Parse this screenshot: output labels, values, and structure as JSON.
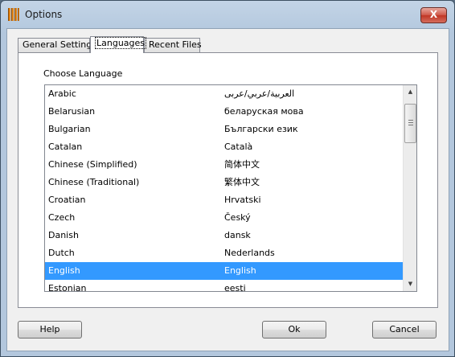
{
  "window": {
    "title": "Options",
    "close_label": "X"
  },
  "tabs": [
    {
      "label": "General Settings",
      "active": false
    },
    {
      "label": "Languages",
      "active": true
    },
    {
      "label": "Recent Files",
      "active": false
    }
  ],
  "languages": {
    "label": "Choose Language",
    "selected": "English",
    "items": [
      {
        "name": "Arabic",
        "native": "العربية/عربي/عربى"
      },
      {
        "name": "Belarusian",
        "native": "беларуская мова"
      },
      {
        "name": "Bulgarian",
        "native": "Български език"
      },
      {
        "name": "Catalan",
        "native": "Català"
      },
      {
        "name": "Chinese (Simplified)",
        "native": "简体中文"
      },
      {
        "name": "Chinese (Traditional)",
        "native": "繁体中文"
      },
      {
        "name": "Croatian",
        "native": "Hrvatski"
      },
      {
        "name": "Czech",
        "native": "Český"
      },
      {
        "name": "Danish",
        "native": "dansk"
      },
      {
        "name": "Dutch",
        "native": "Nederlands"
      },
      {
        "name": "English",
        "native": "English"
      },
      {
        "name": "Estonian",
        "native": "eesti"
      }
    ]
  },
  "scrollbar": {
    "up_icon": "▲",
    "down_icon": "▼",
    "position": 0.12
  },
  "buttons": {
    "help": "Help",
    "ok": "Ok",
    "cancel": "Cancel"
  },
  "colors": {
    "selection": "#3399ff",
    "close_button": "#c9402e",
    "app_icon": "#e08418"
  }
}
